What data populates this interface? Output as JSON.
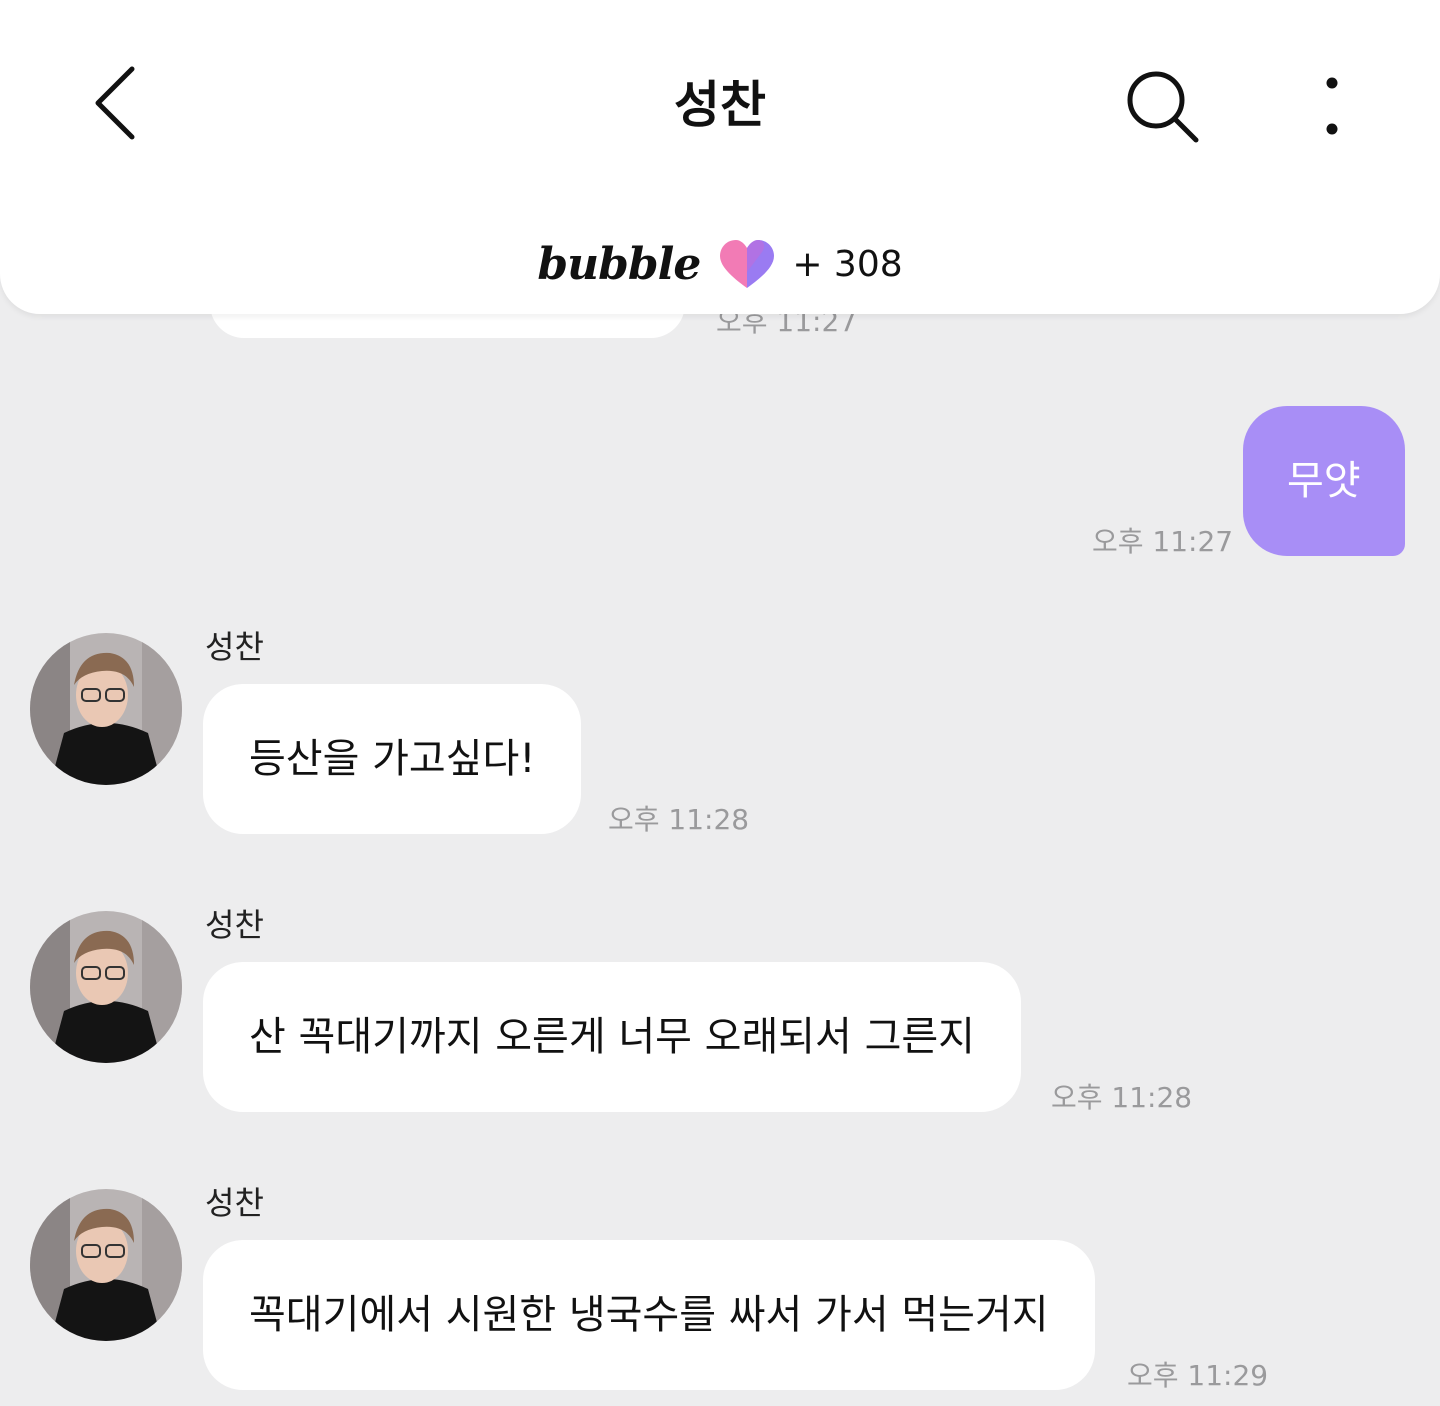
{
  "header": {
    "title": "성찬",
    "brand": "bubble",
    "count": "+ 308"
  },
  "colors": {
    "background": "#ededee",
    "sent_bubble": "#a88ef6",
    "received_bubble": "#ffffff",
    "time_text": "#9a9a9c",
    "heart_pink": "#f27bb5",
    "heart_purple": "#9a7bf2"
  },
  "icons": {
    "back": "chevron-left-icon",
    "search": "search-icon",
    "more": "more-vertical-icon",
    "heart": "heart-icon"
  },
  "messages": [
    {
      "type": "received-partial",
      "time": "오후 11:27"
    },
    {
      "type": "sent",
      "text": "무얏",
      "time": "오후 11:27"
    },
    {
      "type": "received",
      "sender": "성찬",
      "text": "등산을 가고싶다!",
      "time": "오후 11:28"
    },
    {
      "type": "received",
      "sender": "성찬",
      "text": "산 꼭대기까지 오른게 너무 오래되서 그른지",
      "time": "오후 11:28"
    },
    {
      "type": "received",
      "sender": "성찬",
      "text": "꼭대기에서 시원한 냉국수를 싸서 가서 먹는거지",
      "time": "오후 11:29"
    }
  ]
}
